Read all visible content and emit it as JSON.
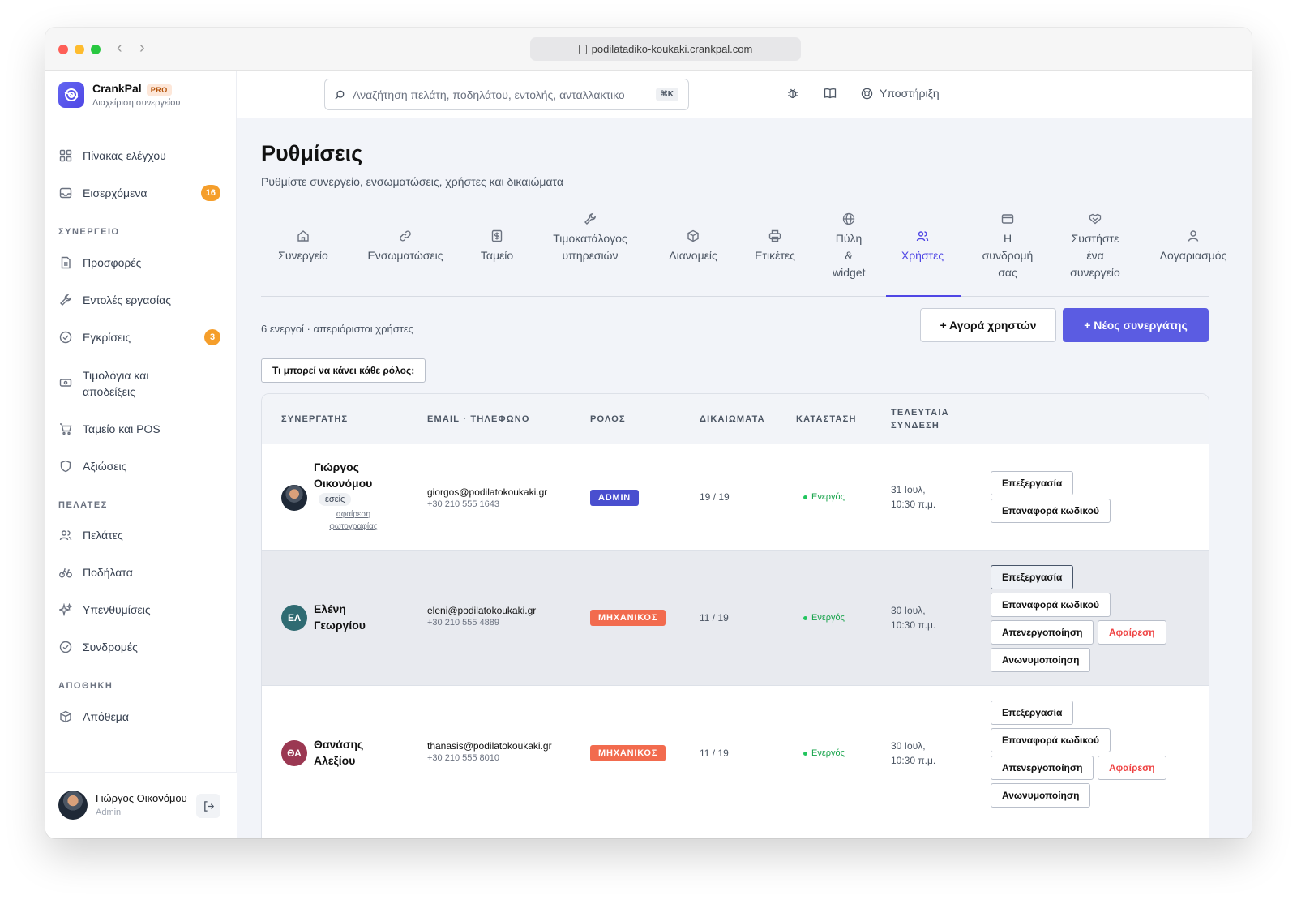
{
  "browser": {
    "url": "podilatadiko-koukaki.crankpal.com"
  },
  "brand": {
    "name": "CrankPal",
    "badge": "PRO",
    "subtitle": "Διαχείριση συνεργείου"
  },
  "search": {
    "placeholder": "Αναζήτηση πελάτη, ποδηλάτου, εντολής, ανταλλακτικο",
    "shortcut": "⌘K"
  },
  "topbar": {
    "support": "Υποστήριξη"
  },
  "sidebar": {
    "dashboard": "Πίνακας ελέγχου",
    "inbox": "Εισερχόμενα",
    "inbox_count": "16",
    "section_shop": "ΣΥΝΕΡΓΕΙΟ",
    "offers": "Προσφορές",
    "work_orders": "Εντολές εργασίας",
    "approvals": "Εγκρίσεις",
    "approvals_count": "3",
    "invoices": "Τιμολόγια και αποδείξεις",
    "pos": "Ταμείο και POS",
    "claims": "Αξιώσεις",
    "section_customers": "ΠΕΛΑΤΕΣ",
    "customers": "Πελάτες",
    "bikes": "Ποδήλατα",
    "reminders": "Υπενθυμίσεις",
    "subscriptions": "Συνδρομές",
    "section_storage": "ΑΠΟΘΗΚΗ",
    "stock": "Απόθεμα",
    "user_name": "Γιώργος Οικονόμου",
    "user_role": "Admin"
  },
  "page": {
    "title": "Ρυθμίσεις",
    "subtitle": "Ρυθμίστε συνεργείο, ενσωματώσεις, χρήστες και δικαιώματα"
  },
  "tabs": [
    {
      "label": "Συνεργείο",
      "icon": "home-icon"
    },
    {
      "label": "Ενσωματώσεις",
      "icon": "link-icon"
    },
    {
      "label": "Ταμείο",
      "icon": "cash-icon"
    },
    {
      "label": "Τιμοκατάλογος υπηρεσιών",
      "icon": "wrench-icon"
    },
    {
      "label": "Διανομείς",
      "icon": "box-icon"
    },
    {
      "label": "Ετικέτες",
      "icon": "printer-icon"
    },
    {
      "label": "Πύλη & widget",
      "icon": "globe-icon"
    },
    {
      "label": "Χρήστες",
      "icon": "users-icon",
      "active": true
    },
    {
      "label": "Η συνδρομή σας",
      "icon": "card-icon"
    },
    {
      "label": "Συστήστε ένα συνεργείο",
      "icon": "handshake-icon"
    },
    {
      "label": "Λογαριασμός",
      "icon": "user-icon"
    }
  ],
  "users_panel": {
    "count_text": "6 ενεργοί · απεριόριστοι χρήστες",
    "buy_button": "+ Αγορά χρηστών",
    "new_button": "+ Νέος συνεργάτης",
    "roles_button": "Τι μπορεί να κάνει κάθε ρόλος;"
  },
  "table": {
    "headers": {
      "partner": "ΣΥΝΕΡΓΑΤΗΣ",
      "contact": "EMAIL · ΤΗΛΕΦΩΝΟ",
      "role": "ΡΟΛΟΣ",
      "permissions": "ΔΙΚΑΙΩΜΑΤΑ",
      "status": "ΚΑΤΑΣΤΑΣΗ",
      "last_login": "ΤΕΛΕΥΤΑΙΑ ΣΥΝΔΕΣΗ"
    },
    "rows": [
      {
        "name": "Γιώργος Οικονόμου",
        "you_tag": "εσείς",
        "remove_photo": "αφαίρεση φωτογραφίας",
        "email": "giorgos@podilatokoukaki.gr",
        "phone": "+30 210 555 1643",
        "role": "ADMIN",
        "role_color": "#4a4fcf",
        "permissions": "19 / 19",
        "status": "Ενεργός",
        "last_login": "31 Ιουλ, 10:30 π.μ.",
        "actions": [
          "Επεξεργασία",
          "Επαναφορά κωδικού"
        ]
      },
      {
        "name": "Ελένη Γεωργίου",
        "initials": "ΕΛ",
        "avatar_color": "#2f6b72",
        "email": "eleni@podilatokoukaki.gr",
        "phone": "+30 210 555 4889",
        "role": "ΜΗΧΑΝΙΚΟΣ",
        "role_color": "#f26b4e",
        "permissions": "11 / 19",
        "status": "Ενεργός",
        "last_login": "30 Ιουλ, 10:30 π.μ.",
        "actions": [
          "Επεξεργασία",
          "Επαναφορά κωδικού",
          "Απενεργοποίηση",
          "Αφαίρεση",
          "Ανωνυμοποίηση"
        ]
      },
      {
        "name": "Θανάσης Αλεξίου",
        "initials": "ΘΑ",
        "avatar_color": "#9b3852",
        "email": "thanasis@podilatokoukaki.gr",
        "phone": "+30 210 555 8010",
        "role": "ΜΗΧΑΝΙΚΟΣ",
        "role_color": "#f26b4e",
        "permissions": "11 / 19",
        "status": "Ενεργός",
        "last_login": "30 Ιουλ, 10:30 π.μ.",
        "actions": [
          "Επεξεργασία",
          "Επαναφορά κωδικού",
          "Απενεργοποίηση",
          "Αφαίρεση",
          "Ανωνυμοποίηση"
        ]
      }
    ]
  }
}
